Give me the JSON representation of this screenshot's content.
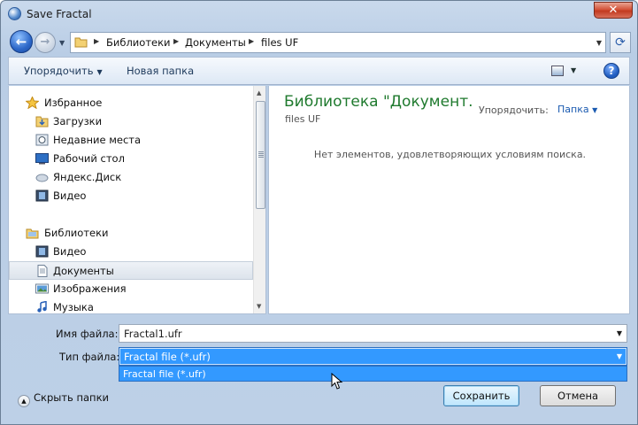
{
  "window": {
    "title": "Save Fractal",
    "close_glyph": "✕"
  },
  "nav": {
    "back_glyph": "←",
    "forward_glyph": "→",
    "history_glyph": "▼"
  },
  "address": {
    "crumbs": [
      "Библиотеки",
      "Документы",
      "files UF"
    ],
    "separator": "▶",
    "dropdown_glyph": "▼",
    "refresh_glyph": "⟳"
  },
  "toolbar": {
    "organize": "Упорядочить",
    "new_folder": "Новая папка",
    "help": "?"
  },
  "sidebar": {
    "favorites": [
      {
        "label": "Избранное",
        "icon": "star-icon"
      },
      {
        "label": "Загрузки",
        "icon": "downloads-folder-icon"
      },
      {
        "label": "Недавние места",
        "icon": "recent-places-icon"
      },
      {
        "label": "Рабочий стол",
        "icon": "desktop-icon"
      },
      {
        "label": "Яндекс.Диск",
        "icon": "cloud-icon"
      },
      {
        "label": "Видео",
        "icon": "video-icon"
      }
    ],
    "libraries": [
      {
        "label": "Библиотеки",
        "icon": "libraries-icon"
      },
      {
        "label": "Видео",
        "icon": "video-icon"
      },
      {
        "label": "Документы",
        "icon": "documents-icon",
        "selected": true
      },
      {
        "label": "Изображения",
        "icon": "pictures-icon"
      },
      {
        "label": "Музыка",
        "icon": "music-icon"
      }
    ]
  },
  "content": {
    "title": "Библиотека \"Документ...",
    "subtitle": "files UF",
    "arrange_label": "Упорядочить:",
    "arrange_value": "Папка",
    "empty_message": "Нет элементов, удовлетворяющих условиям поиска."
  },
  "form": {
    "filename_label": "Имя файла:",
    "filename_value": "Fractal1.ufr",
    "filetype_label": "Тип файла:",
    "filetype_value": "Fractal file (*.ufr)",
    "filetype_options": [
      "Fractal file (*.ufr)"
    ]
  },
  "footer": {
    "hide_folders": "Скрыть папки",
    "save": "Сохранить",
    "cancel": "Отмена"
  },
  "colors": {
    "accent": "#3399ff",
    "library_title": "#1f7a2e",
    "link": "#1a5ab0"
  }
}
